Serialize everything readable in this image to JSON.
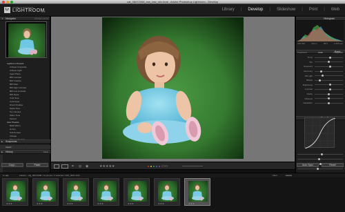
{
  "window": {
    "title": "cat_06072008_ess_raw_mix.lrcat - Adobe Photoshop Lightroom - Develop"
  },
  "identity": {
    "badge": "Lr",
    "small": "ADOBE PHOTOSHOP",
    "name": "LIGHTROOM",
    "version": "1.4"
  },
  "modules": [
    "Library",
    "Develop",
    "Slideshow",
    "Print",
    "Web"
  ],
  "active_module": "Develop",
  "left_panel": {
    "navigator": {
      "label": "Navigator",
      "zoom": [
        "FIT",
        "FILL",
        "1:1",
        "3:1"
      ]
    },
    "presets_items": [
      "Lightroom Presets",
      "Antique Grayscale",
      "Antique Light",
      "Aged Photo",
      "BW Contrast",
      "BW Creative",
      "BW Filter",
      "BW High Contrast",
      "BW Low Contrast",
      "BW Sepia",
      "Cold Tone",
      "Cyanotype",
      "Direct Positive",
      "Sepia Tone",
      "Toy Camera",
      "Warm Tone",
      "Zeroed",
      "User Presets",
      "B&W Warm",
      "Hi Key",
      "Soft Portrait",
      "Vintage",
      "Sharpen Portrait",
      "Sharpen Landscape",
      "Cross Process"
    ],
    "sections": [
      "Snapshots",
      "History"
    ],
    "history_item": "Import",
    "history_clear": "Clear",
    "buttons": [
      "Copy...",
      "Paste"
    ]
  },
  "right_panel": {
    "histogram_label": "Histogram",
    "histogram_values": [
      "ISO 200",
      "24mm",
      "f/8.0",
      "1/125 sec"
    ],
    "basic_label": "Basic",
    "treatment": [
      "Treatment:",
      "Color",
      "Grayscale"
    ],
    "sliders": [
      {
        "label": "Temp",
        "level": 0.55
      },
      {
        "label": "Tint",
        "level": 0.5
      },
      {
        "label": "Exposure",
        "level": 0.55
      },
      {
        "label": "Recovery",
        "level": 0.2
      },
      {
        "label": "Fill Light",
        "level": 0.25
      },
      {
        "label": "Blacks",
        "level": 0.15
      },
      {
        "label": "Brightness",
        "level": 0.55
      },
      {
        "label": "Contrast",
        "level": 0.55
      },
      {
        "label": "Clarity",
        "level": 0.5
      },
      {
        "label": "Vibrance",
        "level": 0.5
      },
      {
        "label": "Saturation",
        "level": 0.5
      }
    ],
    "tone_curve_label": "Tone Curve",
    "buttons": [
      "Auto Sync",
      "Reset"
    ]
  },
  "toolbar": {
    "color_labels": [
      "#c0392b",
      "#e0c034",
      "#3da53a",
      "#3b70c4",
      "#8a49b2"
    ]
  },
  "filmstrip": {
    "path": "Folders : stig_06072008 / 12 photos / 1 selected / IMG_0001.CR2",
    "filter": "Filter :",
    "stars": "★★★",
    "thumbnails": [
      {
        "selected": false
      },
      {
        "selected": false
      },
      {
        "selected": false
      },
      {
        "selected": false
      },
      {
        "selected": false
      },
      {
        "selected": false
      },
      {
        "selected": true
      }
    ]
  }
}
